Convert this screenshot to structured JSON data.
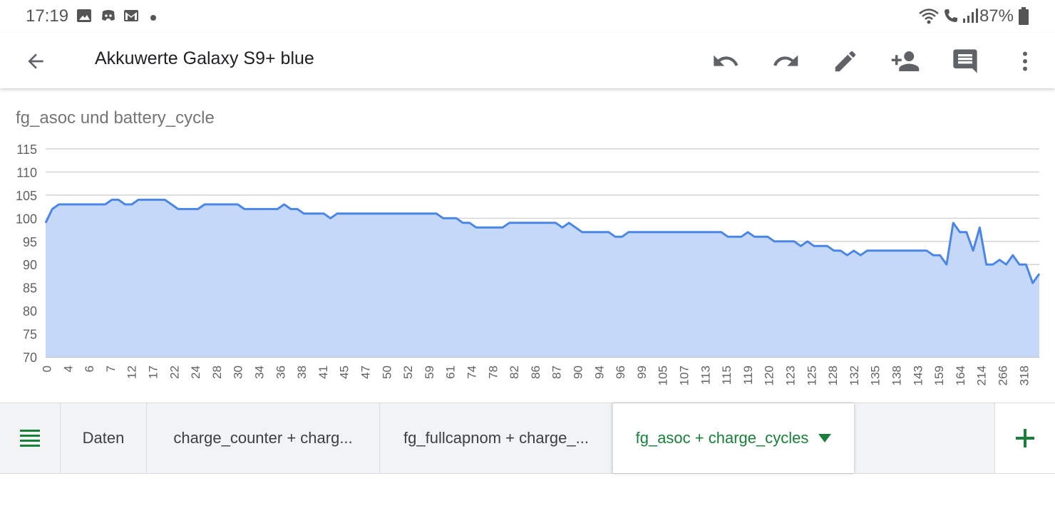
{
  "status_bar": {
    "time": "17:19",
    "battery": "87%"
  },
  "app_bar": {
    "title": "Akkuwerte Galaxy S9+ blue"
  },
  "chart": {
    "title": "fg_asoc und battery_cycle"
  },
  "chart_data": {
    "type": "area",
    "title": "fg_asoc und battery_cycle",
    "xlabel": "",
    "ylabel": "",
    "ylim": [
      70,
      115
    ],
    "yticks": [
      70,
      75,
      80,
      85,
      90,
      95,
      100,
      105,
      110,
      115
    ],
    "grid": true,
    "x_tick_labels": [
      "0",
      "4",
      "6",
      "7",
      "12",
      "17",
      "22",
      "24",
      "28",
      "30",
      "34",
      "36",
      "38",
      "41",
      "45",
      "47",
      "50",
      "52",
      "59",
      "61",
      "74",
      "78",
      "82",
      "86",
      "87",
      "90",
      "94",
      "96",
      "99",
      "105",
      "107",
      "113",
      "115",
      "119",
      "120",
      "123",
      "125",
      "128",
      "132",
      "135",
      "138",
      "143",
      "159",
      "164",
      "214",
      "266",
      "318"
    ],
    "series": [
      {
        "color": "#4a86e8",
        "fill": "#c5d8f7",
        "values": [
          99,
          102,
          103,
          103,
          103,
          103,
          103,
          103,
          103,
          103,
          104,
          104,
          103,
          103,
          104,
          104,
          104,
          104,
          104,
          103,
          102,
          102,
          102,
          102,
          103,
          103,
          103,
          103,
          103,
          103,
          102,
          102,
          102,
          102,
          102,
          102,
          103,
          102,
          102,
          101,
          101,
          101,
          101,
          100,
          101,
          101,
          101,
          101,
          101,
          101,
          101,
          101,
          101,
          101,
          101,
          101,
          101,
          101,
          101,
          101,
          100,
          100,
          100,
          99,
          99,
          98,
          98,
          98,
          98,
          98,
          99,
          99,
          99,
          99,
          99,
          99,
          99,
          99,
          98,
          99,
          98,
          97,
          97,
          97,
          97,
          97,
          96,
          96,
          97,
          97,
          97,
          97,
          97,
          97,
          97,
          97,
          97,
          97,
          97,
          97,
          97,
          97,
          97,
          96,
          96,
          96,
          97,
          96,
          96,
          96,
          95,
          95,
          95,
          95,
          94,
          95,
          94,
          94,
          94,
          93,
          93,
          92,
          93,
          92,
          93,
          93,
          93,
          93,
          93,
          93,
          93,
          93,
          93,
          93,
          92,
          92,
          90,
          99,
          97,
          97,
          93,
          98,
          90,
          90,
          91,
          90,
          92,
          90,
          90,
          86,
          88
        ]
      }
    ]
  },
  "tabs": {
    "items": [
      {
        "label": "Daten"
      },
      {
        "label": "charge_counter + charg..."
      },
      {
        "label": "fg_fullcapnom + charge_..."
      },
      {
        "label": "fg_asoc + charge_cycles"
      }
    ]
  }
}
